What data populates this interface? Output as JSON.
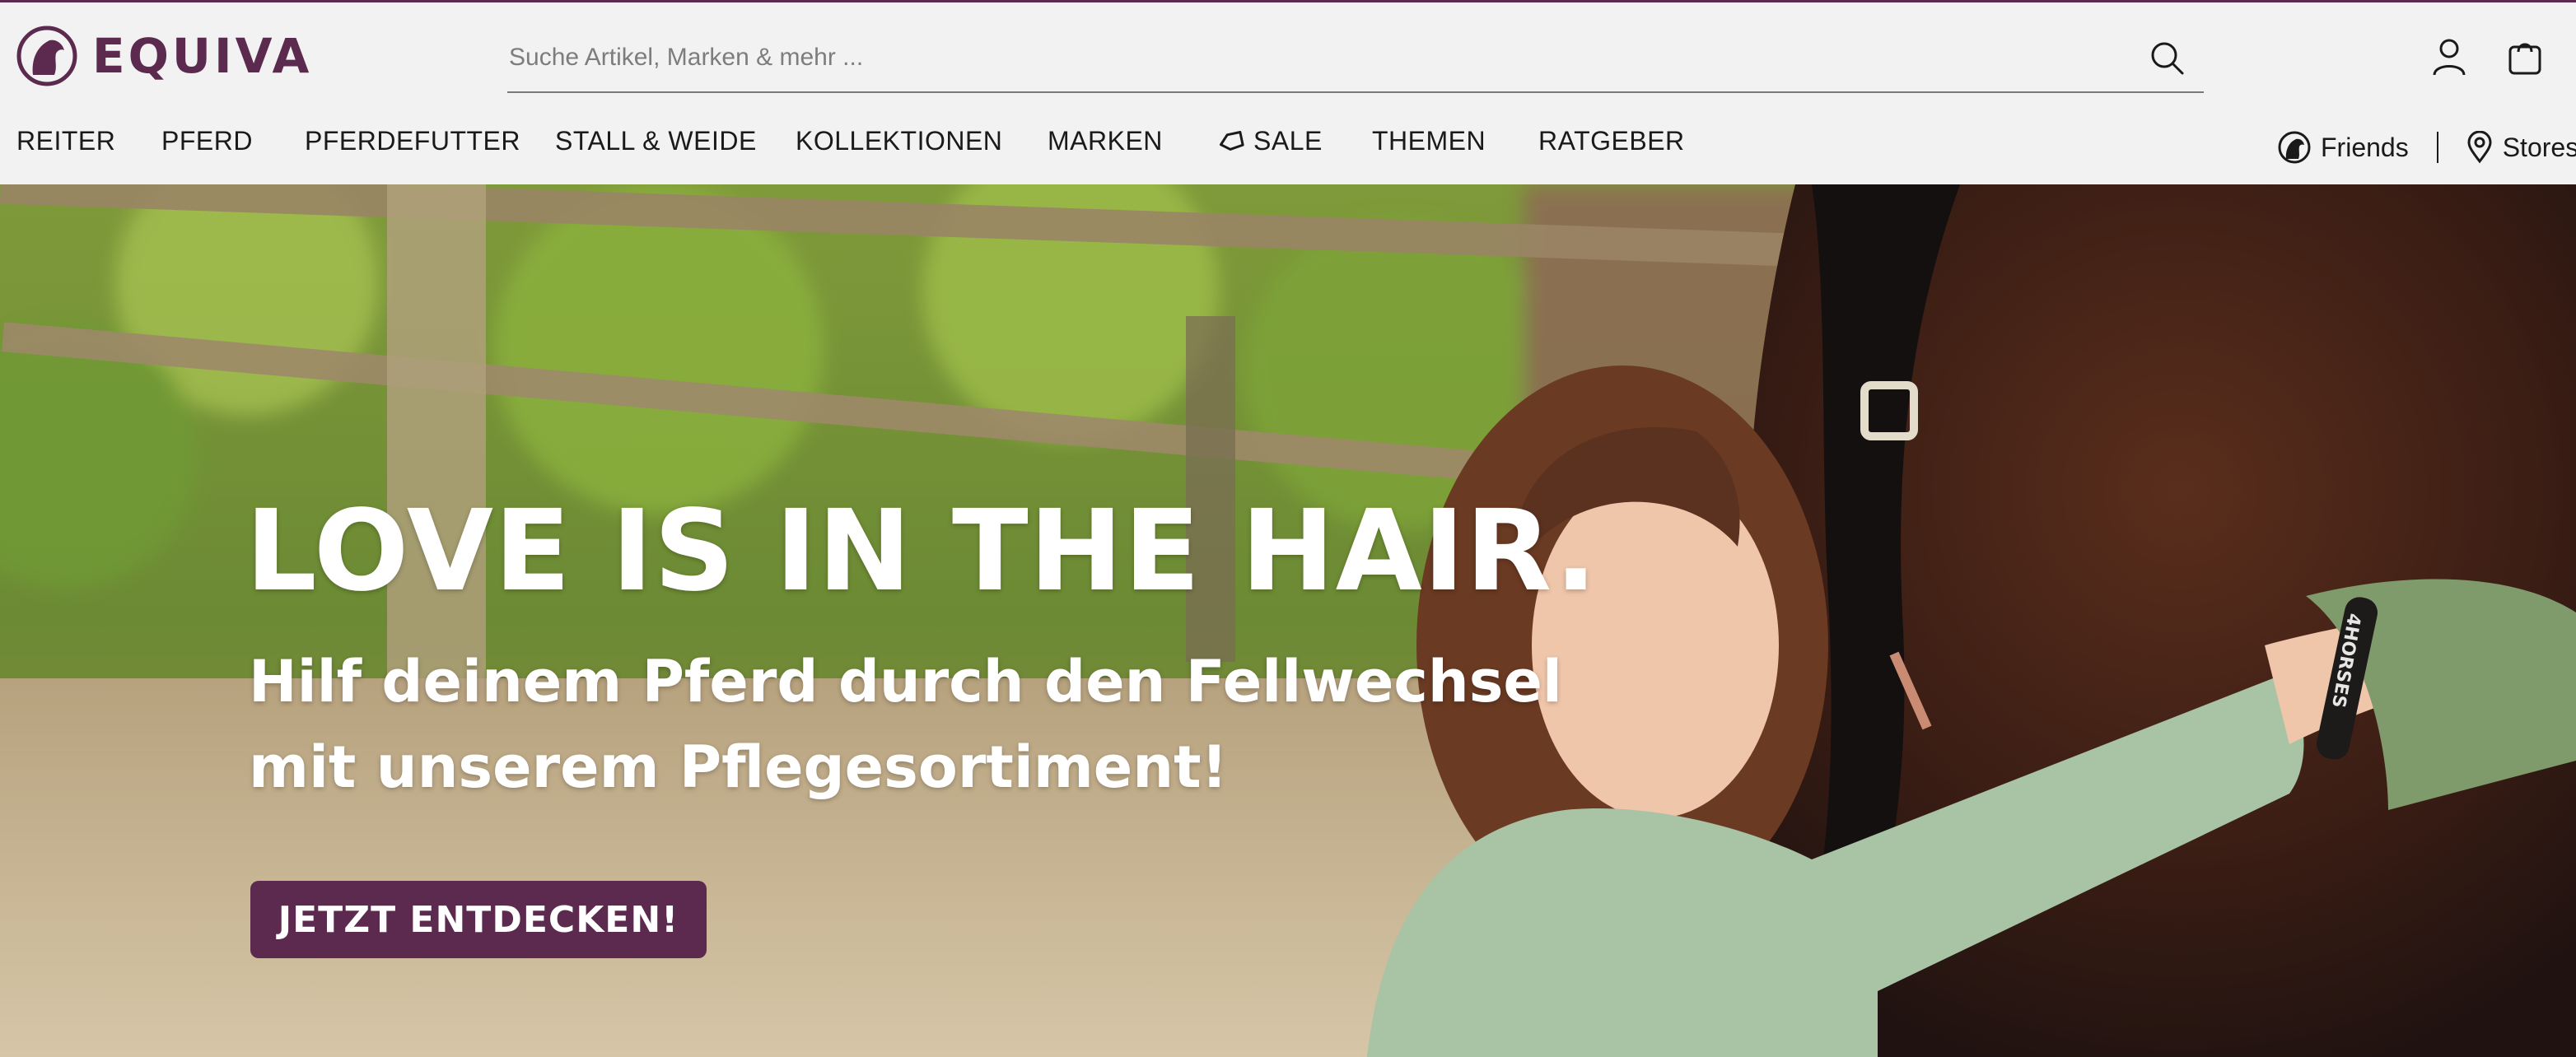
{
  "brand": {
    "name": "EQUIVA",
    "color": "#5b2a4e"
  },
  "search": {
    "placeholder": "Suche Artikel, Marken & mehr ..."
  },
  "header_icons": [
    "user-icon",
    "shopping-bag-icon"
  ],
  "nav": {
    "items": [
      {
        "label": "REITER"
      },
      {
        "label": "PFERD"
      },
      {
        "label": "PFERDEFUTTER"
      },
      {
        "label": "STALL & WEIDE"
      },
      {
        "label": "KOLLEKTIONEN"
      },
      {
        "label": "MARKEN"
      },
      {
        "label": "SALE",
        "icon": "tag-icon"
      },
      {
        "label": "THEMEN"
      },
      {
        "label": "RATGEBER"
      }
    ],
    "friends": "Friends",
    "stores": "Stores"
  },
  "hero": {
    "title": "LOVE IS IN THE HAIR.",
    "subtitle_line1": "Hilf deinem Pferd durch den Fellwechsel",
    "subtitle_line2": "mit unserem Pflegesortiment!",
    "cta": "JETZT ENTDECKEN!",
    "halter_text": "4HORSES"
  }
}
